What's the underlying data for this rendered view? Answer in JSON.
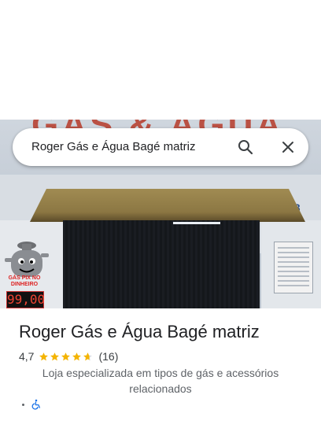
{
  "search": {
    "query": "Roger Gás e Água Bagé matriz",
    "search_icon": "search-icon",
    "clear_icon": "close-icon"
  },
  "photo": {
    "sign_text": "GÁS & ÁGUA",
    "number_text": "78",
    "mascot_caption": "GÁS PIX NO DINHEIRO",
    "price_text": "99,00"
  },
  "place": {
    "name": "Roger Gás e Água Bagé matriz",
    "rating": "4,7",
    "rating_value": 4.7,
    "review_count": "(16)",
    "category": "Loja especializada em tipos de gás e acessórios relacionados",
    "accessibility_icon": "wheelchair-icon"
  },
  "colors": {
    "star": "#f4b400",
    "accessibility": "#1a73e8"
  }
}
